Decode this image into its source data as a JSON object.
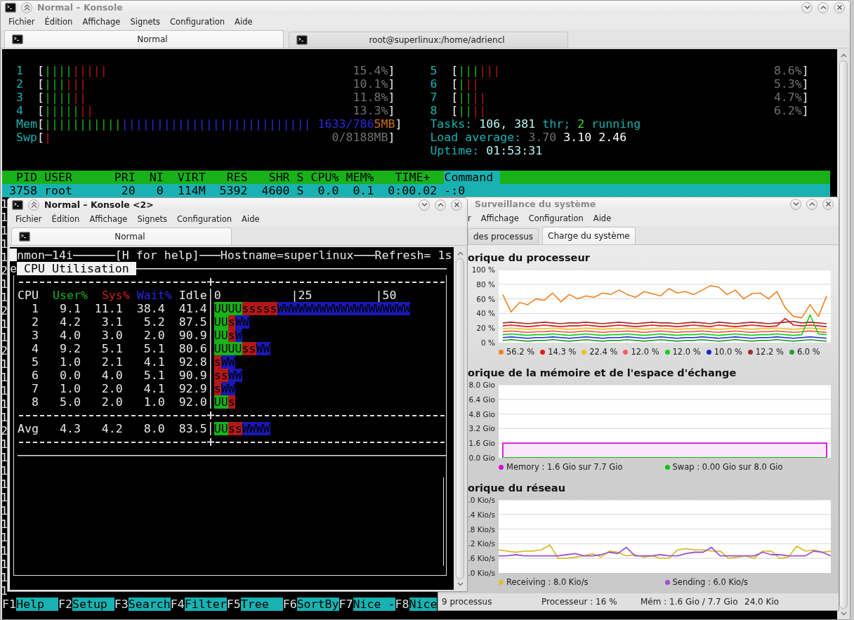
{
  "konsole_main": {
    "kind": "konsole",
    "title": "Normal – Konsole",
    "active": false,
    "menu": [
      "Fichier",
      "Édition",
      "Affichage",
      "Signets",
      "Configuration",
      "Aide"
    ],
    "tabs": [
      {
        "label": "Normal",
        "selected": true
      },
      {
        "label": "root@superlinux:/home/adriencl",
        "selected": false
      }
    ],
    "htop": {
      "left_column": [
        {
          "kind": "meter",
          "label": "1",
          "open": "[",
          "bars": [
            {
              "kind": "user",
              "text": "||||"
            },
            {
              "kind": "system",
              "text": "|||||"
            }
          ],
          "reading": [
            {
              "kind": "dim",
              "text": "15.4%"
            }
          ],
          "close": "]"
        },
        {
          "kind": "meter",
          "label": "2",
          "open": "[",
          "bars": [
            {
              "kind": "user",
              "text": "|||"
            },
            {
              "kind": "system",
              "text": "|||"
            }
          ],
          "reading": [
            {
              "kind": "dim",
              "text": "10.1%"
            }
          ],
          "close": "]"
        },
        {
          "kind": "meter",
          "label": "3",
          "open": "[",
          "bars": [
            {
              "kind": "user",
              "text": "||||"
            },
            {
              "kind": "system",
              "text": "||"
            }
          ],
          "reading": [
            {
              "kind": "dim",
              "text": "11.8%"
            }
          ],
          "close": "]"
        },
        {
          "kind": "meter",
          "label": "4",
          "open": "[",
          "bars": [
            {
              "kind": "user",
              "text": "|||||"
            },
            {
              "kind": "system",
              "text": "||"
            }
          ],
          "reading": [
            {
              "kind": "dim",
              "text": "13.3%"
            }
          ],
          "close": "]"
        },
        {
          "kind": "meter",
          "label": "Mem",
          "open": "[",
          "bars": [
            {
              "kind": "used",
              "text": "|||||||||||"
            },
            {
              "kind": "buffers",
              "text": "|||||||||||||||||||||||||||"
            }
          ],
          "reading": [
            {
              "kind": "buffers",
              "text": "1633/786"
            },
            {
              "kind": "cache",
              "text": "5MB"
            }
          ],
          "close": "]"
        },
        {
          "kind": "meter",
          "label": "Swp",
          "open": "[",
          "bars": [
            {
              "kind": "system",
              "text": "|"
            }
          ],
          "reading": [
            {
              "kind": "dim",
              "text": "0/8188MB"
            }
          ],
          "close": "]"
        }
      ],
      "right_column": [
        {
          "kind": "meter",
          "label": "5",
          "open": "[",
          "bars": [
            {
              "kind": "user",
              "text": "|||"
            },
            {
              "kind": "system",
              "text": "|||"
            }
          ],
          "reading": [
            {
              "kind": "dim",
              "text": "8.6%"
            }
          ],
          "close": "]"
        },
        {
          "kind": "meter",
          "label": "6",
          "open": "[",
          "bars": [
            {
              "kind": "user",
              "text": "|"
            },
            {
              "kind": "system",
              "text": "||"
            }
          ],
          "reading": [
            {
              "kind": "dim",
              "text": "5.3%"
            }
          ],
          "close": "]"
        },
        {
          "kind": "meter",
          "label": "7",
          "open": "[",
          "bars": [
            {
              "kind": "user",
              "text": "||"
            },
            {
              "kind": "system",
              "text": "||"
            }
          ],
          "reading": [
            {
              "kind": "dim",
              "text": "4.7%"
            }
          ],
          "close": "]"
        },
        {
          "kind": "meter",
          "label": "8",
          "open": "[",
          "bars": [
            {
              "kind": "user",
              "text": "||"
            },
            {
              "kind": "system",
              "text": "||"
            }
          ],
          "reading": [
            {
              "kind": "dim",
              "text": "6.2%"
            }
          ],
          "close": "]"
        },
        {
          "kind": "info",
          "parts": [
            {
              "kind": "label",
              "text": "Tasks: "
            },
            {
              "kind": "value",
              "text": "106, 381"
            },
            {
              "kind": "label",
              "text": " thr; "
            },
            {
              "kind": "running",
              "text": "2"
            },
            {
              "kind": "label",
              "text": " running"
            }
          ]
        },
        {
          "kind": "info",
          "parts": [
            {
              "kind": "label",
              "text": "Load average: "
            },
            {
              "kind": "dim",
              "text": "3.70 "
            },
            {
              "kind": "bright",
              "text": "3.10 2.46"
            }
          ]
        },
        {
          "kind": "info",
          "parts": [
            {
              "kind": "label",
              "text": "Uptime: "
            },
            {
              "kind": "value",
              "text": "01:53:31"
            }
          ]
        }
      ],
      "columns": [
        {
          "label": "PID",
          "selected": false
        },
        {
          "label": "USER",
          "selected": false
        },
        {
          "label": "PRI",
          "selected": false
        },
        {
          "label": "NI",
          "selected": false
        },
        {
          "label": "VIRT",
          "selected": false
        },
        {
          "label": "RES",
          "selected": false
        },
        {
          "label": "SHR",
          "selected": false
        },
        {
          "label": "S",
          "selected": false
        },
        {
          "label": "CPU%",
          "selected": false
        },
        {
          "label": "MEM%",
          "selected": false
        },
        {
          "label": "TIME+",
          "selected": false
        },
        {
          "label": "Command",
          "selected": true
        }
      ],
      "rows": [
        {
          "kind": "full",
          "selected": true,
          "cells": [
            "3758",
            "root",
            "20",
            "0",
            "114M",
            "5392",
            "4600",
            "S",
            "0.0",
            "0.1",
            "0:00.02",
            "-:0"
          ]
        },
        {
          "kind": "clipped",
          "selected": false,
          "cells": [
            "1"
          ]
        },
        {
          "kind": "clipped",
          "selected": false,
          "cells": [
            "1"
          ]
        },
        {
          "kind": "clipped",
          "selected": false,
          "cells": [
            "1"
          ]
        },
        {
          "kind": "clipped",
          "selected": false,
          "cells": [
            "1"
          ]
        },
        {
          "kind": "clipped",
          "selected": false,
          "cells": [
            "1"
          ]
        },
        {
          "kind": "clipped",
          "selected": false,
          "cells": [
            "2"
          ]
        },
        {
          "kind": "clipped",
          "selected": false,
          "cells": [
            "1"
          ]
        },
        {
          "kind": "clipped",
          "selected": false,
          "cells": [
            "1"
          ]
        },
        {
          "kind": "clipped",
          "selected": false,
          "cells": [
            "2"
          ]
        },
        {
          "kind": "clipped",
          "selected": false,
          "cells": [
            "1"
          ]
        },
        {
          "kind": "clipped",
          "selected": false,
          "cells": [
            "1"
          ]
        },
        {
          "kind": "clipped",
          "selected": false,
          "cells": [
            "2"
          ]
        },
        {
          "kind": "clipped",
          "selected": false,
          "cells": [
            "1"
          ]
        },
        {
          "kind": "clipped",
          "selected": false,
          "cells": [
            "1"
          ]
        },
        {
          "kind": "clipped",
          "selected": false,
          "cells": [
            "1"
          ]
        },
        {
          "kind": "clipped",
          "selected": false,
          "cells": [
            "1"
          ]
        },
        {
          "kind": "clipped",
          "selected": false,
          "cells": [
            "1"
          ]
        },
        {
          "kind": "clipped",
          "selected": false,
          "cells": [
            "2"
          ]
        },
        {
          "kind": "clipped",
          "selected": false,
          "cells": [
            "1"
          ]
        },
        {
          "kind": "clipped",
          "selected": false,
          "cells": [
            "1"
          ]
        },
        {
          "kind": "clipped",
          "selected": false,
          "cells": [
            "1"
          ]
        },
        {
          "kind": "clipped",
          "selected": false,
          "cells": [
            "1"
          ]
        },
        {
          "kind": "clipped",
          "selected": false,
          "cells": [
            "1"
          ]
        },
        {
          "kind": "clipped",
          "selected": false,
          "cells": [
            "1"
          ]
        },
        {
          "kind": "clipped",
          "selected": false,
          "cells": [
            "1"
          ]
        },
        {
          "kind": "clipped",
          "selected": false,
          "cells": [
            "1"
          ]
        },
        {
          "kind": "clipped",
          "selected": false,
          "cells": [
            "1"
          ]
        },
        {
          "kind": "clipped",
          "selected": false,
          "cells": [
            "1"
          ]
        },
        {
          "kind": "clipped",
          "selected": false,
          "cells": [
            "1"
          ]
        },
        {
          "kind": "clipped",
          "selected": false,
          "cells": [
            "1"
          ]
        }
      ],
      "function_keys": [
        {
          "key": "F1",
          "label": "Help"
        },
        {
          "key": "F2",
          "label": "Setup"
        },
        {
          "key": "F3",
          "label": "Search"
        },
        {
          "key": "F4",
          "label": "Filter"
        },
        {
          "key": "F5",
          "label": "Tree"
        },
        {
          "key": "F6",
          "label": "SortBy"
        },
        {
          "key": "F7",
          "label": "Nice -"
        },
        {
          "key": "F8",
          "label": "Nice"
        }
      ]
    }
  },
  "konsole_nmon": {
    "kind": "konsole",
    "title": "Normal – Konsole <2>",
    "active": true,
    "menu": [
      "Fichier",
      "Édition",
      "Affichage",
      "Signets",
      "Configuration",
      "Aide"
    ],
    "tabs": [
      {
        "label": "Normal",
        "selected": true
      }
    ],
    "nmon": {
      "cursor_visible": true,
      "header": [
        "nmon─14i",
        "[H for help]",
        "Hostname=superlinux",
        "Refresh= 1s"
      ],
      "leading_char": "e",
      "section_title": "CPU Utilisation",
      "columns": [
        {
          "label": "CPU",
          "kind": "cpu"
        },
        {
          "label": "User%",
          "kind": "user"
        },
        {
          "label": "Sys%",
          "kind": "sys"
        },
        {
          "label": "Wait%",
          "kind": "wait"
        },
        {
          "label": "Idle",
          "kind": "idle"
        }
      ],
      "scale": [
        "0",
        "|25",
        "|50"
      ],
      "rows": [
        {
          "cells": [
            "1",
            "9.1",
            "11.1",
            "38.4",
            "41.4"
          ],
          "bars": [
            {
              "kind": "user",
              "text": "UUUU"
            },
            {
              "kind": "sys",
              "text": "sssss"
            },
            {
              "kind": "wait",
              "text": "WWWWWWWWWWWWWWWWWWW"
            }
          ]
        },
        {
          "cells": [
            "2",
            "4.2",
            "3.1",
            "5.2",
            "87.5"
          ],
          "bars": [
            {
              "kind": "user",
              "text": "UU"
            },
            {
              "kind": "sys",
              "text": "s"
            },
            {
              "kind": "wait",
              "text": "WW"
            }
          ]
        },
        {
          "cells": [
            "3",
            "4.0",
            "3.0",
            "2.0",
            "90.9"
          ],
          "bars": [
            {
              "kind": "user",
              "text": "UU"
            },
            {
              "kind": "sys",
              "text": "s"
            },
            {
              "kind": "wait",
              "text": "W"
            }
          ]
        },
        {
          "cells": [
            "4",
            "9.2",
            "5.1",
            "5.1",
            "80.6"
          ],
          "bars": [
            {
              "kind": "user",
              "text": "UUUU"
            },
            {
              "kind": "sys",
              "text": "ss"
            },
            {
              "kind": "wait",
              "text": "WW"
            }
          ]
        },
        {
          "cells": [
            "5",
            "1.0",
            "2.1",
            "4.1",
            "92.8"
          ],
          "bars": [
            {
              "kind": "sys",
              "text": "s"
            },
            {
              "kind": "wait",
              "text": "WW"
            }
          ]
        },
        {
          "cells": [
            "6",
            "0.0",
            "4.0",
            "5.1",
            "90.9"
          ],
          "bars": [
            {
              "kind": "sys",
              "text": "ss"
            },
            {
              "kind": "wait",
              "text": "WW"
            }
          ]
        },
        {
          "cells": [
            "7",
            "1.0",
            "2.0",
            "4.1",
            "92.9"
          ],
          "bars": [
            {
              "kind": "sys",
              "text": "s"
            },
            {
              "kind": "wait",
              "text": "WW"
            }
          ]
        },
        {
          "cells": [
            "8",
            "5.0",
            "2.0",
            "1.0",
            "92.0"
          ],
          "bars": [
            {
              "kind": "user",
              "text": "UU"
            },
            {
              "kind": "sys",
              "text": "s"
            }
          ]
        }
      ],
      "average": {
        "cells": [
          "Avg",
          "4.3",
          "4.2",
          "8.0",
          "83.5"
        ],
        "bars": [
          {
            "kind": "user",
            "text": "UU"
          },
          {
            "kind": "sys",
            "text": "ss"
          },
          {
            "kind": "wait",
            "text": "WWWW"
          }
        ]
      }
    }
  },
  "system_monitor": {
    "kind": "monitor",
    "title": "Surveillance du système",
    "active": false,
    "menu": [
      "r",
      "Affichage",
      "Configuration",
      "Aide"
    ],
    "tabs": [
      {
        "label": "des processus",
        "selected": false
      },
      {
        "label": "Charge du système",
        "selected": true
      }
    ],
    "sections": [
      {
        "kind": "chart",
        "heading": "orique du processeur",
        "chart_data": {
          "type": "line",
          "grid": true,
          "ylim": [
            0,
            100
          ],
          "yticks": [
            {
              "value": 0,
              "label": "0 %"
            },
            {
              "value": 20,
              "label": "20 %"
            },
            {
              "value": 40,
              "label": "40 %"
            },
            {
              "value": 60,
              "label": "60 %"
            },
            {
              "value": 80,
              "label": "80 %"
            },
            {
              "value": 100,
              "label": "100 %"
            }
          ],
          "series": [
            {
              "name": "56.2 %",
              "color": "#f08020",
              "values": [
                66,
                42,
                55,
                52,
                60,
                58,
                68,
                56,
                66,
                60,
                64,
                62,
                68,
                66,
                72,
                66,
                62,
                70,
                67,
                64,
                74,
                68,
                70,
                66,
                72,
                78,
                76,
                66,
                72,
                60,
                67,
                68,
                60,
                70,
                48,
                36,
                34,
                52,
                36,
                64
              ]
            },
            {
              "name": "14.3 %",
              "color": "#e01818",
              "values": [
                23,
                24,
                23,
                22,
                23,
                24,
                23,
                22,
                23,
                23,
                24,
                23,
                22,
                23,
                24,
                23,
                22,
                23,
                24,
                23,
                23,
                22,
                23,
                24,
                23,
                22,
                24,
                23,
                22,
                23,
                24,
                23,
                22,
                23,
                33,
                24,
                23,
                24,
                23,
                22
              ]
            },
            {
              "name": "22.4 %",
              "color": "#f0c010",
              "values": [
                19,
                20,
                19,
                18,
                19,
                19,
                20,
                19,
                18,
                19,
                20,
                19,
                18,
                19,
                19,
                20,
                19,
                18,
                19,
                20,
                19,
                18,
                19,
                19,
                20,
                19,
                18,
                19,
                20,
                19,
                18,
                19,
                19,
                20,
                19,
                18,
                19,
                20,
                19,
                18
              ]
            },
            {
              "name": "12.0 %",
              "color": "#ff5a5a",
              "values": [
                15,
                16,
                15,
                14,
                15,
                15,
                16,
                15,
                14,
                15,
                16,
                15,
                14,
                15,
                15,
                16,
                15,
                14,
                15,
                16,
                15,
                14,
                15,
                15,
                16,
                15,
                14,
                15,
                16,
                15,
                14,
                15,
                15,
                16,
                15,
                14,
                15,
                16,
                15,
                14
              ]
            },
            {
              "name": "12.0 %",
              "color": "#10d010",
              "values": [
                11,
                12,
                11,
                10,
                11,
                11,
                12,
                11,
                10,
                11,
                12,
                11,
                10,
                11,
                11,
                12,
                11,
                10,
                11,
                12,
                11,
                10,
                11,
                11,
                12,
                11,
                10,
                11,
                12,
                11,
                10,
                11,
                11,
                12,
                11,
                10,
                11,
                38,
                12,
                11
              ]
            },
            {
              "name": "10.0 %",
              "color": "#1828d0",
              "values": [
                7,
                8,
                7,
                6,
                7,
                7,
                8,
                7,
                6,
                7,
                8,
                7,
                6,
                7,
                7,
                8,
                7,
                6,
                7,
                8,
                7,
                6,
                7,
                7,
                8,
                7,
                6,
                7,
                8,
                7,
                6,
                7,
                7,
                8,
                7,
                6,
                7,
                8,
                7,
                6
              ]
            },
            {
              "name": "12.2 %",
              "color": "#a03030",
              "values": [
                27,
                28,
                27,
                26,
                27,
                28,
                27,
                26,
                27,
                27,
                28,
                27,
                26,
                27,
                28,
                27,
                26,
                27,
                28,
                27,
                27,
                26,
                27,
                28,
                27,
                26,
                28,
                27,
                26,
                27,
                28,
                27,
                26,
                27,
                28,
                29,
                27,
                28,
                27,
                26
              ]
            },
            {
              "name": "6.0 %",
              "color": "#2a9a3a",
              "values": [
                3,
                4,
                3,
                2,
                3,
                3,
                4,
                3,
                2,
                3,
                4,
                3,
                2,
                3,
                3,
                4,
                3,
                2,
                3,
                4,
                3,
                2,
                3,
                3,
                4,
                3,
                2,
                3,
                4,
                3,
                2,
                3,
                3,
                4,
                3,
                2,
                3,
                4,
                3,
                2
              ]
            }
          ]
        }
      },
      {
        "kind": "chart",
        "heading": "orique de la mémoire et de l'espace d'échange",
        "chart_data": {
          "type": "area",
          "grid": true,
          "ylim": [
            0,
            8
          ],
          "yticks": [
            {
              "value": 0,
              "label": "0.0 Gio"
            },
            {
              "value": 1.6,
              "label": "1.6 Gio"
            },
            {
              "value": 3.2,
              "label": "3.2 Gio"
            },
            {
              "value": 4.8,
              "label": "4.8 Gio"
            },
            {
              "value": 6.4,
              "label": "6.4 Gio"
            },
            {
              "value": 8,
              "label": "8.0 Gio"
            }
          ],
          "series": [
            {
              "name": "Memory : 1.6 Gio sur 7.7 Gio",
              "color": "#d010d0",
              "values": [
                1.6,
                1.6,
                1.6,
                1.6,
                1.6,
                1.6,
                1.6,
                1.6,
                1.6,
                1.6,
                1.6,
                1.6,
                1.6,
                1.6,
                1.6,
                1.6,
                1.6,
                1.6,
                1.6,
                1.6,
                1.6,
                1.6,
                1.6,
                1.6,
                1.6,
                1.6,
                1.6,
                1.6,
                1.6,
                1.6,
                1.6,
                1.6,
                1.6,
                1.6,
                1.6,
                1.6,
                1.6,
                1.6,
                1.6,
                1.6
              ]
            },
            {
              "name": "Swap : 0.00 Gio sur 8.0 Gio",
              "color": "#10c010",
              "values": [
                0,
                0,
                0,
                0,
                0,
                0,
                0,
                0,
                0,
                0,
                0,
                0,
                0,
                0,
                0,
                0,
                0,
                0,
                0,
                0,
                0,
                0,
                0,
                0,
                0,
                0,
                0,
                0,
                0,
                0,
                0,
                0,
                0,
                0,
                0,
                0,
                0,
                0,
                0,
                0
              ]
            }
          ]
        }
      },
      {
        "kind": "graphic",
        "heading": "orique du réseau",
        "axis_labels": [
          ".0 Kio/s",
          ".4 Kio/s",
          ".8 Kio/s",
          ".2 Kio/s",
          ".6 Kio/s",
          ".0 Kio/s"
        ],
        "legend": [
          {
            "label": "Receiving : 8.0 Kio/s",
            "color": "#d8c030"
          },
          {
            "label": "Sending : 6.0 Kio/s",
            "color": "#a050d0"
          }
        ]
      }
    ],
    "status_bar": [
      "9 processus",
      "Processeur : 16 %",
      "Mém : 1.6 Gio / 7.7 Gio",
      "24.0 Kio"
    ]
  }
}
